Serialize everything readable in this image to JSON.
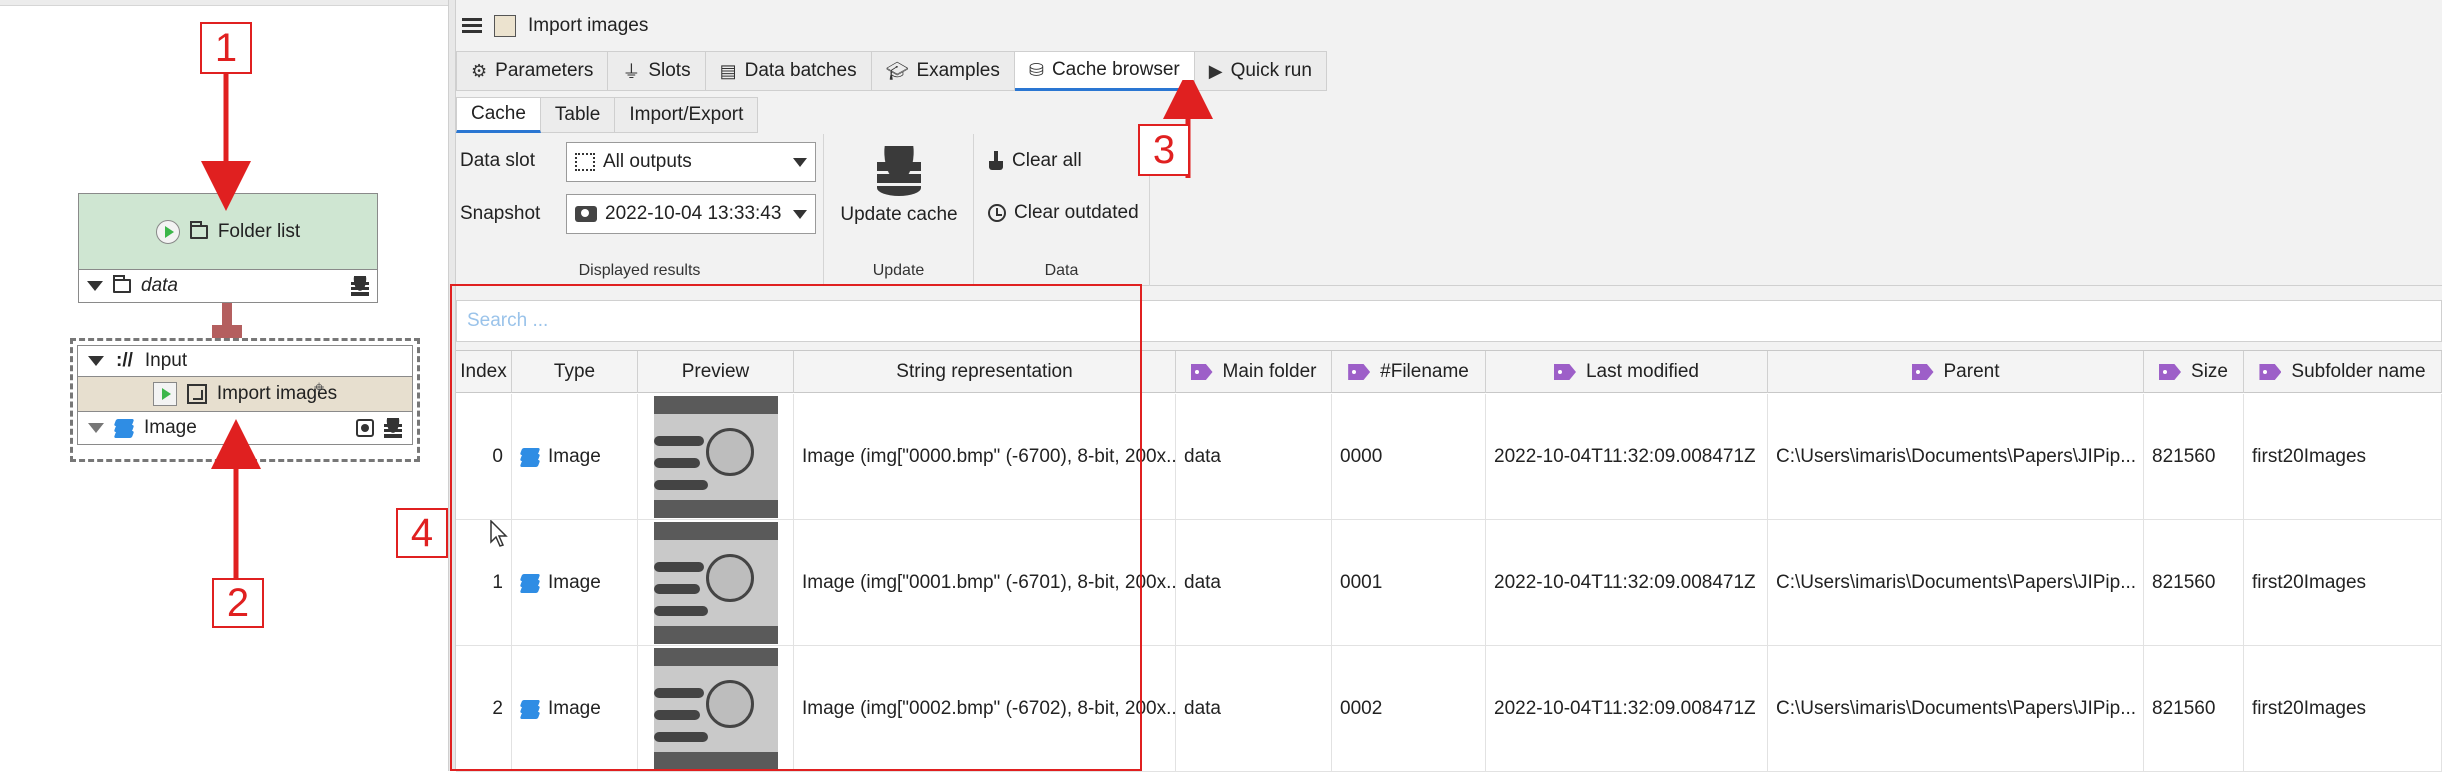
{
  "graph": {
    "folder_node": {
      "title": "Folder list",
      "output_slot": "data"
    },
    "import_node": {
      "input_slot": "Input",
      "input_prefix": "://",
      "title": "Import images",
      "output_slot": "Image"
    }
  },
  "callouts": [
    "1",
    "2",
    "3",
    "4"
  ],
  "panel": {
    "title": "Import images",
    "tabs": [
      {
        "label": "Parameters",
        "icon": "gear-icon"
      },
      {
        "label": "Slots",
        "icon": "plug-icon"
      },
      {
        "label": "Data batches",
        "icon": "batches-icon"
      },
      {
        "label": "Examples",
        "icon": "graduation-cap-icon"
      },
      {
        "label": "Cache browser",
        "icon": "database-icon"
      },
      {
        "label": "Quick run",
        "icon": "play-icon"
      }
    ],
    "subtabs": [
      "Cache",
      "Table",
      "Import/Export"
    ],
    "toolbar": {
      "data_slot_label": "Data slot",
      "data_slot_value": "All outputs",
      "snapshot_label": "Snapshot",
      "snapshot_value": "2022-10-04 13:33:43",
      "displayed_results": "Displayed results",
      "update_cache": "Update cache",
      "update_group": "Update",
      "clear_all": "Clear all",
      "clear_outdated": "Clear outdated",
      "data_group": "Data"
    },
    "search_placeholder": "Search ...",
    "table": {
      "columns": [
        "Index",
        "Type",
        "Preview",
        "String representation",
        "Main folder",
        "#Filename",
        "Last modified",
        "Parent",
        "Size",
        "Subfolder name"
      ],
      "rows": [
        {
          "index": "0",
          "type": "Image",
          "string": "Image (img[\"0000.bmp\" (-6700), 8-bit, 200x...",
          "main_folder": "data",
          "filename": "0000",
          "last_modified": "2022-10-04T11:32:09.008471Z",
          "parent": "C:\\Users\\imaris\\Documents\\Papers\\JIPip...",
          "size": "821560",
          "subfolder": "first20Images"
        },
        {
          "index": "1",
          "type": "Image",
          "string": "Image (img[\"0001.bmp\" (-6701), 8-bit, 200x...",
          "main_folder": "data",
          "filename": "0001",
          "last_modified": "2022-10-04T11:32:09.008471Z",
          "parent": "C:\\Users\\imaris\\Documents\\Papers\\JIPip...",
          "size": "821560",
          "subfolder": "first20Images"
        },
        {
          "index": "2",
          "type": "Image",
          "string": "Image (img[\"0002.bmp\" (-6702), 8-bit, 200x...",
          "main_folder": "data",
          "filename": "0002",
          "last_modified": "2022-10-04T11:32:09.008471Z",
          "parent": "C:\\Users\\imaris\\Documents\\Papers\\JIPip...",
          "size": "821560",
          "subfolder": "first20Images"
        }
      ]
    }
  },
  "colors": {
    "accent": "#2a76d2",
    "annotation": "#e02020",
    "node_green": "#cfe6d2",
    "node_tan": "#e7dfcf",
    "tag_purple": "#9d5fc8",
    "image_blue": "#2f8de4"
  }
}
